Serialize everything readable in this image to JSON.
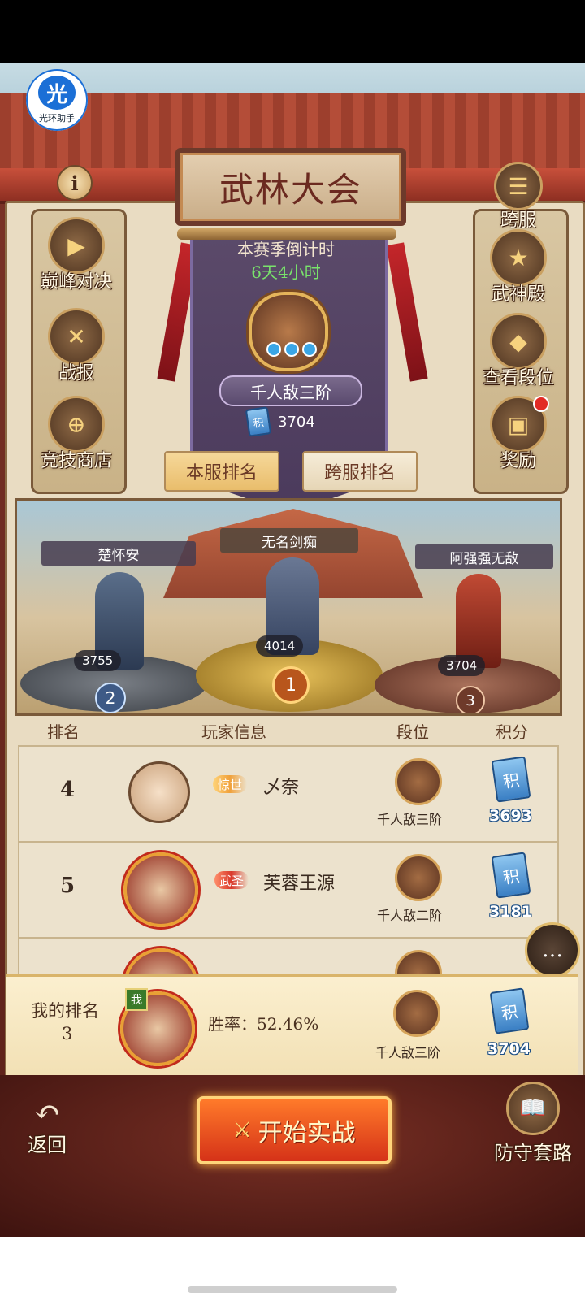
{
  "overlay": {
    "badge_glyph": "光",
    "badge_text": "光环助手"
  },
  "header": {
    "title": "武林大会",
    "info_glyph": "i"
  },
  "left_menu": [
    {
      "label": "巅峰对决",
      "glyph": "▶"
    },
    {
      "label": "战报",
      "glyph": "✕"
    },
    {
      "label": "竞技商店",
      "glyph": "⊕"
    }
  ],
  "right_menu": [
    {
      "label": "跨服",
      "glyph": "☰"
    },
    {
      "label": "武神殿",
      "glyph": "★"
    },
    {
      "label": "查看段位",
      "glyph": "◆"
    },
    {
      "label": "奖励",
      "glyph": "▣"
    }
  ],
  "season": {
    "countdown_label": "本赛季倒计时",
    "countdown_value": "6天4小时",
    "rank_title": "千人敌三阶",
    "points": "3704",
    "points_glyph": "积"
  },
  "tabs": [
    {
      "label": "本服排名",
      "active": true
    },
    {
      "label": "跨服排名",
      "active": false
    }
  ],
  "podium": [
    {
      "place": "2",
      "name": "楚怀安",
      "points": "3755"
    },
    {
      "place": "1",
      "name": "无名剑痴",
      "points": "4014"
    },
    {
      "place": "3",
      "name": "阿强强无敌",
      "points": "3704"
    }
  ],
  "table": {
    "headers": {
      "rank": "排名",
      "player": "玩家信息",
      "segment": "段位",
      "score": "积分"
    },
    "rows": [
      {
        "rank": "4",
        "tag": "惊世",
        "name": "乄奈",
        "segment": "千人敌三阶",
        "score": "3693",
        "score_glyph": "积"
      },
      {
        "rank": "5",
        "tag": "武圣",
        "name": "芙蓉王源",
        "segment": "千人敌二阶",
        "score": "3181",
        "score_glyph": "积"
      }
    ]
  },
  "my_rank": {
    "label": "我的排名",
    "rank": "3",
    "me_tag": "我",
    "winrate": "胜率：52.46%",
    "segment": "千人敌三阶",
    "score": "3704",
    "score_glyph": "积"
  },
  "bottom": {
    "back_label": "返回",
    "back_glyph": "↶",
    "start_label": "开始实战",
    "defense_label": "防守套路",
    "defense_glyph": "📖"
  },
  "chat_glyph": "…"
}
